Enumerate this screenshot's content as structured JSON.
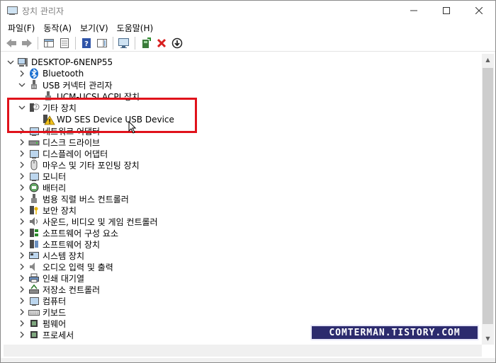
{
  "window": {
    "title": "장치 관리자"
  },
  "menubar": [
    "파일(F)",
    "동작(A)",
    "보기(V)",
    "도움말(H)"
  ],
  "toolbar_icons": [
    "back-arrow-icon",
    "forward-arrow-icon",
    "properties-pane-icon",
    "properties-icon",
    "help-icon",
    "view-icon",
    "monitor-icon",
    "add-driver-icon",
    "uninstall-icon",
    "update-driver-icon"
  ],
  "tree": {
    "root": "DESKTOP-6NENP55",
    "items": [
      {
        "label": "Bluetooth",
        "level": 1,
        "expander": ">",
        "icon": "bluetooth-icon"
      },
      {
        "label": "USB 커넥터 관리자",
        "level": 1,
        "expander": "v",
        "icon": "usb-icon"
      },
      {
        "label": "UCM-UCSI ACPI 장치",
        "level": 2,
        "expander": "",
        "icon": "usb-icon"
      },
      {
        "label": "기타 장치",
        "level": 1,
        "expander": "v",
        "icon": "unknown-device-icon"
      },
      {
        "label": "WD SES Device USB Device",
        "level": 2,
        "expander": "",
        "icon": "warning-device-icon"
      },
      {
        "label": "네트워크 어댑터",
        "level": 1,
        "expander": ">",
        "icon": "network-icon"
      },
      {
        "label": "디스크 드라이브",
        "level": 1,
        "expander": ">",
        "icon": "disk-icon"
      },
      {
        "label": "디스플레이 어댑터",
        "level": 1,
        "expander": ">",
        "icon": "display-icon"
      },
      {
        "label": "마우스 및 기타 포인팅 장치",
        "level": 1,
        "expander": ">",
        "icon": "mouse-icon"
      },
      {
        "label": "모니터",
        "level": 1,
        "expander": ">",
        "icon": "monitor-icon"
      },
      {
        "label": "배터리",
        "level": 1,
        "expander": ">",
        "icon": "battery-icon"
      },
      {
        "label": "범용 직렬 버스 컨트롤러",
        "level": 1,
        "expander": ">",
        "icon": "usb-icon"
      },
      {
        "label": "보안 장치",
        "level": 1,
        "expander": ">",
        "icon": "security-icon"
      },
      {
        "label": "사운드, 비디오 및 게임 컨트롤러",
        "level": 1,
        "expander": ">",
        "icon": "sound-icon"
      },
      {
        "label": "소프트웨어 구성 요소",
        "level": 1,
        "expander": ">",
        "icon": "software-icon"
      },
      {
        "label": "소프트웨어 장치",
        "level": 1,
        "expander": ">",
        "icon": "software-icon"
      },
      {
        "label": "시스템 장치",
        "level": 1,
        "expander": ">",
        "icon": "system-icon"
      },
      {
        "label": "오디오 입력 및 출력",
        "level": 1,
        "expander": ">",
        "icon": "audio-icon"
      },
      {
        "label": "인쇄 대기열",
        "level": 1,
        "expander": ">",
        "icon": "printer-icon"
      },
      {
        "label": "저장소 컨트롤러",
        "level": 1,
        "expander": ">",
        "icon": "storage-icon"
      },
      {
        "label": "컴퓨터",
        "level": 1,
        "expander": ">",
        "icon": "computer-icon"
      },
      {
        "label": "키보드",
        "level": 1,
        "expander": ">",
        "icon": "keyboard-icon"
      },
      {
        "label": "펌웨어",
        "level": 1,
        "expander": ">",
        "icon": "firmware-icon"
      },
      {
        "label": "프로세서",
        "level": 1,
        "expander": ">",
        "icon": "processor-icon"
      }
    ]
  },
  "watermark": "COMTERMAN.TISTORY.COM",
  "colors": {
    "highlight": "#e0121b",
    "watermark_bg": "#2c2b6e",
    "selection_text": "#000000"
  }
}
